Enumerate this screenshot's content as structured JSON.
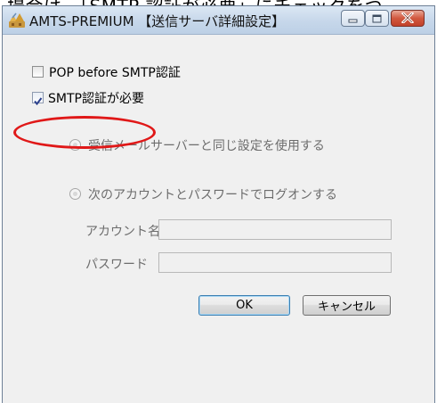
{
  "page_top_text": "場合は、「SMTP 認証が必要」にチェックをつ",
  "window": {
    "title": "AMTS-PREMIUM 【送信サーバ詳細設定】",
    "icon": "app-logo-icon",
    "controls": [
      "minimize-icon",
      "maximize-icon",
      "close-icon"
    ]
  },
  "options": {
    "pop_before_smtp": {
      "label": "POP before SMTP認証",
      "checked": false
    },
    "smtp_auth": {
      "label": "SMTP認証が必要",
      "checked": true
    }
  },
  "auth_mode": {
    "same_settings": {
      "label": "受信メールサーバーと同じ設定を使用する",
      "selected": false
    },
    "use_account": {
      "label": "次のアカウントとパスワードでログオンする",
      "selected": false
    }
  },
  "fields": {
    "account": {
      "label": "アカウント名",
      "value": ""
    },
    "password": {
      "label": "パスワード",
      "value": ""
    }
  },
  "buttons": {
    "ok": "OK",
    "cancel": "キャンセル"
  },
  "colors": {
    "highlight": "#e01818",
    "window_frame": "#6e8096",
    "dialog_background": "#f0f0f0"
  }
}
